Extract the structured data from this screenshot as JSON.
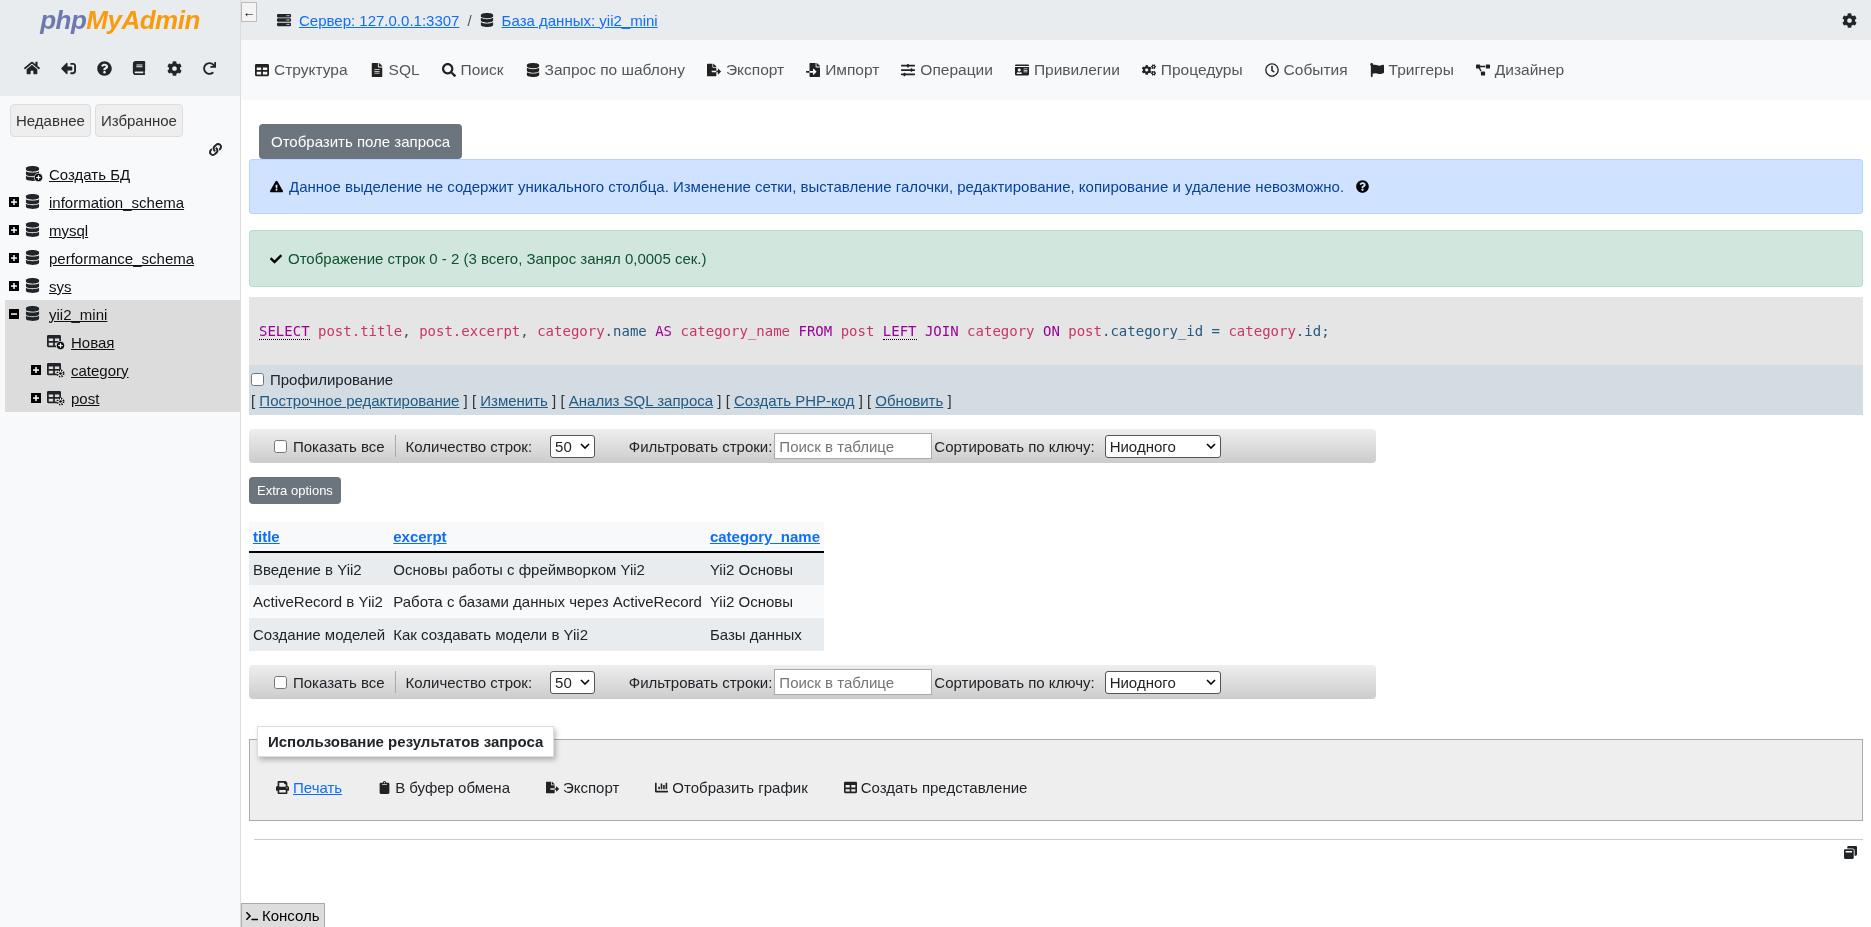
{
  "logo": {
    "part1": "php",
    "part2": "MyAdmin"
  },
  "sidebar": {
    "buttons": [
      "Недавнее",
      "Избранное"
    ],
    "tree": [
      {
        "label": "Создать БД",
        "kind": "create",
        "selected": false
      },
      {
        "label": "information_schema",
        "kind": "database",
        "expanded": false,
        "selected": false
      },
      {
        "label": "mysql",
        "kind": "database",
        "expanded": false,
        "selected": false
      },
      {
        "label": "performance_schema",
        "kind": "database",
        "expanded": false,
        "selected": false
      },
      {
        "label": "sys",
        "kind": "database",
        "expanded": false,
        "selected": false
      },
      {
        "label": "yii2_mini",
        "kind": "database",
        "expanded": true,
        "selected": true,
        "children": [
          {
            "label": "Новая",
            "kind": "create_table",
            "selected": false
          },
          {
            "label": "category",
            "kind": "table",
            "expanded": false,
            "selected": false
          },
          {
            "label": "post",
            "kind": "table",
            "expanded": false,
            "selected": false
          }
        ]
      }
    ]
  },
  "breadcrumb": [
    "Сервер: 127.0.0.1:3307",
    "База данных: yii2_mini"
  ],
  "breadcrumb_separator": "/",
  "collapse_button": "←",
  "tabs": [
    {
      "label": "Структура",
      "selected": false
    },
    {
      "label": "SQL",
      "selected": false
    },
    {
      "label": "Поиск",
      "selected": false
    },
    {
      "label": "Запрос по шаблону",
      "selected": false
    },
    {
      "label": "Экспорт",
      "selected": false
    },
    {
      "label": "Импорт",
      "selected": false
    },
    {
      "label": "Операции",
      "selected": false
    },
    {
      "label": "Привилегии",
      "selected": false
    },
    {
      "label": "Процедуры",
      "selected": false
    },
    {
      "label": "События",
      "selected": false
    },
    {
      "label": "Триггеры",
      "selected": false
    },
    {
      "label": "Дизайнер",
      "selected": false
    }
  ],
  "show_query_button": "Отобразить поле запроса",
  "info_alert": "Данное выделение не содержит уникального столбца. Изменение сетки, выставление галочки, редактирование, копирование и удаление невозможно.",
  "success_alert": "Отображение строк 0 - 2 (3 всего, Запрос занял 0,0005 сек.)",
  "sql": [
    {
      "text": "SELECT",
      "kind": "keyword_link"
    },
    {
      "text": " post.title",
      "kind": "name"
    },
    {
      "text": ", ",
      "kind": "plain"
    },
    {
      "text": "post.excerpt",
      "kind": "name"
    },
    {
      "text": ", ",
      "kind": "plain"
    },
    {
      "text": "category",
      "kind": "name"
    },
    {
      "text": ".name ",
      "kind": "plain"
    },
    {
      "text": "AS",
      "kind": "keyword"
    },
    {
      "text": " category_name",
      "kind": "name"
    },
    {
      "text": " FROM",
      "kind": "keyword"
    },
    {
      "text": " post ",
      "kind": "name"
    },
    {
      "text": "LEFT",
      "kind": "keyword_link"
    },
    {
      "text": " JOIN",
      "kind": "keyword"
    },
    {
      "text": " category",
      "kind": "name"
    },
    {
      "text": " ON",
      "kind": "keyword"
    },
    {
      "text": " post",
      "kind": "name"
    },
    {
      "text": ".category_id = ",
      "kind": "plain"
    },
    {
      "text": "category",
      "kind": "name"
    },
    {
      "text": ".id;",
      "kind": "plain"
    }
  ],
  "profiling": {
    "label": "Профилирование",
    "checked": false
  },
  "query_links": [
    {
      "open": "[",
      "label": "Построчное редактирование",
      "close": "]"
    },
    {
      "open": "[",
      "label": "Изменить",
      "close": "]"
    },
    {
      "open": "[",
      "label": "Анализ SQL запроса",
      "close": "]"
    },
    {
      "open": "[",
      "label": "Создать PHP-код",
      "close": "]"
    },
    {
      "open": "[",
      "label": "Обновить",
      "close": "]"
    }
  ],
  "navigation": [
    {
      "show_all": {
        "label": "Показать все",
        "checked": false
      },
      "rows_label": "Количество строк:",
      "rows_value": "50",
      "filter_label": "Фильтровать строки:",
      "filter_placeholder": "Поиск в таблице",
      "sort_label": "Сортировать по ключу:",
      "sort_value": "Ниодного"
    },
    {
      "show_all": {
        "label": "Показать все",
        "checked": false
      },
      "rows_label": "Количество строк:",
      "rows_value": "50",
      "filter_label": "Фильтровать строки:",
      "filter_placeholder": "Поиск в таблице",
      "sort_label": "Сортировать по ключу:",
      "sort_value": "Ниодного"
    }
  ],
  "extra_options_button": "Extra options",
  "table": {
    "columns": [
      "title",
      "excerpt",
      "category_name"
    ],
    "rows": [
      [
        "Введение в Yii2",
        "Основы работы с фреймворком Yii2",
        "Yii2 Основы"
      ],
      [
        "ActiveRecord в Yii2",
        "Работа с базами данных через ActiveRecord",
        "Yii2 Основы"
      ],
      [
        "Создание моделей",
        "Как создавать модели в Yii2",
        "Базы данных"
      ]
    ]
  },
  "query_results": {
    "legend": "Использование результатов запроса",
    "actions": [
      {
        "label": "Печать",
        "kind": "link"
      },
      {
        "label": "В буфер обмена",
        "kind": "plain"
      },
      {
        "label": "Экспорт",
        "kind": "plain"
      },
      {
        "label": "Отобразить график",
        "kind": "plain"
      },
      {
        "label": "Создать представление",
        "kind": "plain"
      }
    ]
  },
  "console_button": "Консоль"
}
